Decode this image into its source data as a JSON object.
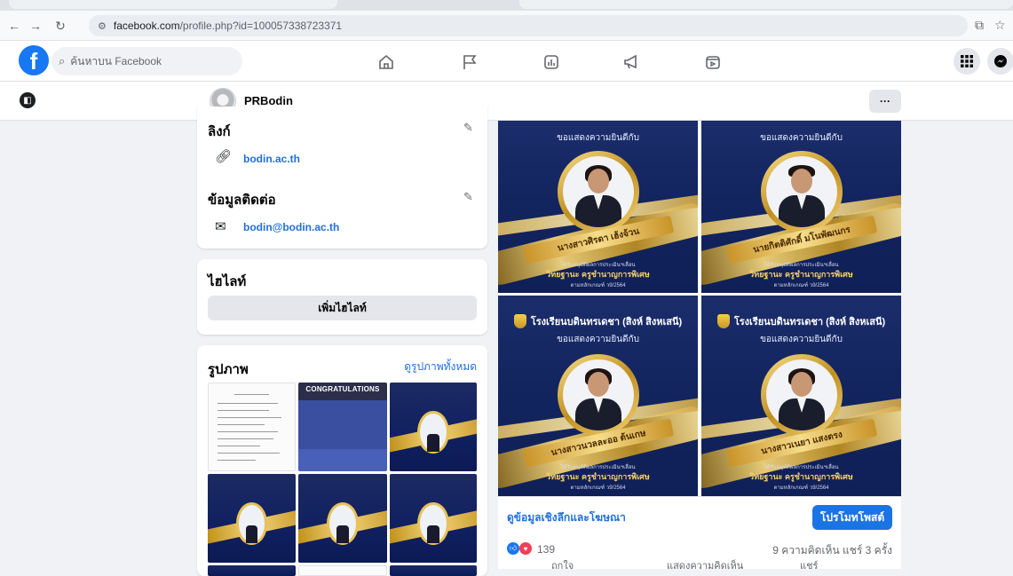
{
  "browser": {
    "url_host": "facebook.com",
    "url_path": "/profile.php?id=100057338723371",
    "back_icon": "arrow-left-icon",
    "forward_icon": "arrow-right-icon",
    "reload_icon": "reload-icon"
  },
  "fb": {
    "logo": "f",
    "search_placeholder": "ค้นหาบน Facebook",
    "nav_icons": [
      "home-icon",
      "flag-icon",
      "gaming-icon",
      "megaphone-icon",
      "watch-icon"
    ]
  },
  "profile": {
    "name": "PRBodin",
    "more_label": "···"
  },
  "links_card": {
    "title": "ลิงก์",
    "website": "bodin.ac.th",
    "contact_title": "ข้อมูลติดต่อ",
    "email": "bodin@bodin.ac.th"
  },
  "highlights_card": {
    "title": "ไฮไลท์",
    "add_label": "เพิ่มไฮไลท์"
  },
  "photos_card": {
    "title": "รูปภาพ",
    "see_all": "ดูรูปภาพทั้งหมด",
    "congrats_text": "CONGRATULATIONS"
  },
  "post": {
    "tiles": [
      {
        "school": "",
        "congrat": "ขอแสดงความยินดีกับ",
        "name": "นางสาวศิรดา เฮ้งจ้วน",
        "small1": "ได้รับอนุมัติผลการประเมินฯเลื่อน",
        "rank": "วิทยฐานะ ครูชำนาญการพิเศษ",
        "small2": "ตามหลักเกณฑ์ ว9/2564"
      },
      {
        "school": "",
        "congrat": "ขอแสดงความยินดีกับ",
        "name": "นายกิตติศักดิ์ มโนพัฒนกร",
        "small1": "ได้รับอนุมัติผลการประเมินฯเลื่อน",
        "rank": "วิทยฐานะ ครูชำนาญการพิเศษ",
        "small2": "ตามหลักเกณฑ์ ว9/2564"
      },
      {
        "school": "โรงเรียนบดินทรเดชา (สิงห์ สิงหเสนี)",
        "congrat": "ขอแสดงความยินดีกับ",
        "name": "นางสาวนวลละออ ต้นเกษ",
        "small1": "ได้รับอนุมัติผลการประเมินฯเลื่อน",
        "rank": "วิทยฐานะ ครูชำนาญการพิเศษ",
        "small2": "ตามหลักเกณฑ์ ว9/2564"
      },
      {
        "school": "โรงเรียนบดินทรเดชา (สิงห์ สิงหเสนี)",
        "congrat": "ขอแสดงความยินดีกับ",
        "name": "นางสาวเนยา แสงตรง",
        "small1": "ได้รับอนุมัติผลการประเมินฯเลื่อน",
        "rank": "วิทยฐานะ ครูชำนาญการพิเศษ",
        "small2": "ตามหลักเกณฑ์ ว9/2564"
      }
    ],
    "insights_label": "ดูข้อมูลเชิงลึกและโฆษณา",
    "promote_label": "โปรโมทโพสต์",
    "reaction_count": "139",
    "comments_shares": "9 ความคิดเห็น  แชร์ 3 ครั้ง",
    "like_label": "ถูกใจ",
    "comment_label": "แสดงความคิดเห็น",
    "share_label": "แชร์"
  },
  "colors": {
    "fb_blue": "#1877f2",
    "link_blue": "#216fdb",
    "navy": "#13255f",
    "gold": "#e7c25a"
  }
}
